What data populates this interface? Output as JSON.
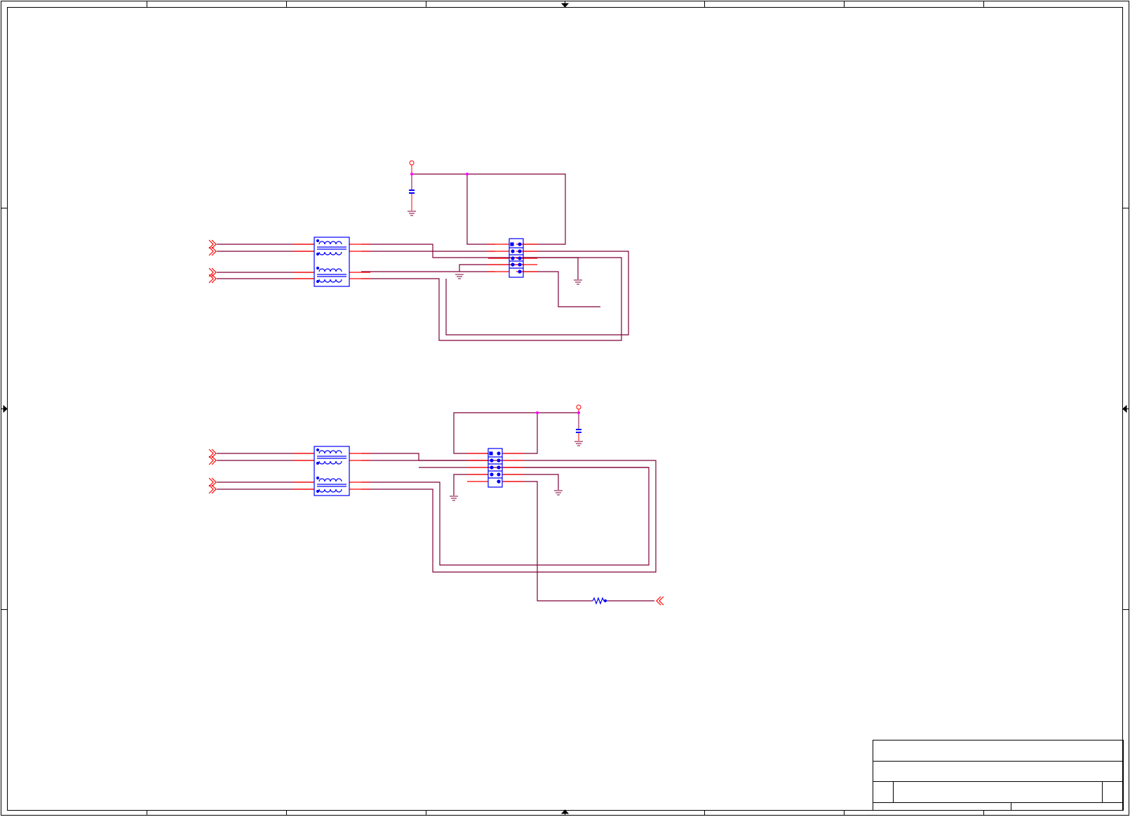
{
  "title_block": {
    "title": "",
    "size": "",
    "document_number": "",
    "revision": "",
    "date": "",
    "sheet": ""
  },
  "colors": {
    "border": "#000000",
    "wire": "#7f0037",
    "pin": "#ff0000",
    "component": "#0000ff",
    "junction": "#ff00ff",
    "background": "#ffffff"
  },
  "icons": {
    "power": "power-symbol-icon",
    "ground": "ground-symbol-icon",
    "port": "offpage-connector-icon",
    "transformer": "transformer-icon",
    "connector": "header-connector-icon",
    "capacitor": "capacitor-icon",
    "resistor": "resistor-icon"
  }
}
